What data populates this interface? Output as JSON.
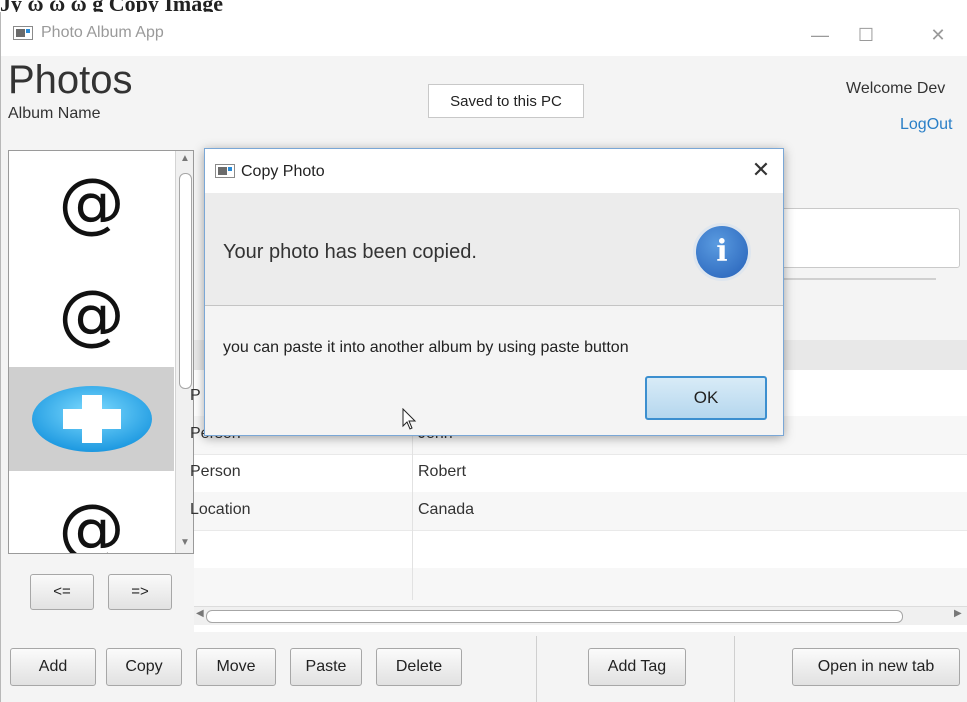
{
  "doc_caption": "Jy ω   ω ω   g Copy Image",
  "window": {
    "title": "Photo Album App",
    "minimize_glyph": "—",
    "maximize_glyph": "☐",
    "close_glyph": "✕"
  },
  "header": {
    "title": "Photos",
    "album_name": "Album Name",
    "saved_status": "Saved to this PC",
    "welcome": "Welcome Dev",
    "logout": "LogOut"
  },
  "thumbnails": [
    {
      "glyph": "@",
      "icon": "at-sign-icon"
    },
    {
      "glyph": "@",
      "icon": "at-sign-icon"
    },
    {
      "glyph": "",
      "icon": "plus-icon",
      "selected": true
    },
    {
      "glyph": "@",
      "icon": "at-sign-icon"
    }
  ],
  "nav": {
    "prev": "<=",
    "next": "=>"
  },
  "tags_table": {
    "rows": [
      {
        "type": "P",
        "value": ""
      },
      {
        "type": "Person",
        "value": "John"
      },
      {
        "type": "Person",
        "value": "Robert"
      },
      {
        "type": "Location",
        "value": "Canada"
      },
      {
        "type": "",
        "value": ""
      },
      {
        "type": "",
        "value": ""
      }
    ]
  },
  "toolbar": {
    "add": "Add",
    "copy": "Copy",
    "move": "Move",
    "paste": "Paste",
    "delete": "Delete",
    "add_tag": "Add Tag",
    "open_new_tab": "Open in new tab"
  },
  "dialog": {
    "title": "Copy Photo",
    "close_glyph": "✕",
    "heading": "Your photo has been copied.",
    "icon_glyph": "i",
    "content": "you can paste it into another album by using paste button",
    "ok": "OK"
  },
  "colors": {
    "accent": "#2a7fc7",
    "ok_border": "#3c8fcf",
    "info_icon": "#2560b8",
    "selected_thumb": "#cfcfcf"
  }
}
